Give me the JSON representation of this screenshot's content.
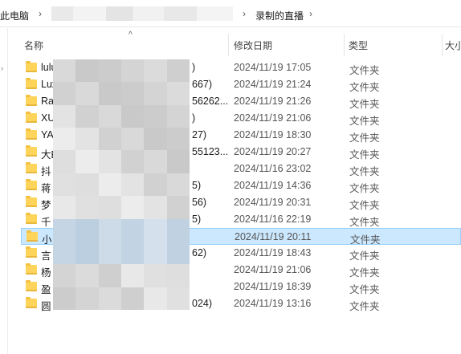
{
  "address": {
    "root": "此电脑",
    "current": "录制的直播"
  },
  "columns": {
    "name": "名称",
    "date": "修改日期",
    "type": "类型",
    "size": "大小"
  },
  "rows": [
    {
      "name": "lulu",
      "name_tail": ")",
      "date": "2024/11/19 17:05",
      "type": "文件夹"
    },
    {
      "name": "Lux",
      "name_tail": "667)",
      "date": "2024/11/19 21:24",
      "type": "文件夹"
    },
    {
      "name": "Ra",
      "name_tail": "56262...",
      "date": "2024/11/19 21:26",
      "type": "文件夹"
    },
    {
      "name": "XU",
      "name_tail": ")",
      "date": "2024/11/19 21:06",
      "type": "文件夹"
    },
    {
      "name": "YA",
      "name_tail": "27)",
      "date": "2024/11/19 18:30",
      "type": "文件夹"
    },
    {
      "name": "大B",
      "name_tail": "55123...",
      "date": "2024/11/19 20:27",
      "type": "文件夹"
    },
    {
      "name": "抖",
      "name_tail": "",
      "date": "2024/11/16 23:02",
      "type": "文件夹"
    },
    {
      "name": "蒋",
      "name_tail": "5)",
      "date": "2024/11/19 14:36",
      "type": "文件夹"
    },
    {
      "name": "梦",
      "name_tail": "56)",
      "date": "2024/11/19 20:31",
      "type": "文件夹"
    },
    {
      "name": "千",
      "name_tail": "5)",
      "date": "2024/11/16 22:19",
      "type": "文件夹"
    },
    {
      "name": "小",
      "name_tail": "",
      "date": "2024/11/19 20:11",
      "type": "文件夹"
    },
    {
      "name": "言",
      "name_tail": "62)",
      "date": "2024/11/19 18:43",
      "type": "文件夹"
    },
    {
      "name": "杨",
      "name_tail": "",
      "date": "2024/11/19 21:06",
      "type": "文件夹"
    },
    {
      "name": "盈",
      "name_tail": "",
      "date": "2024/11/19 18:39",
      "type": "文件夹"
    },
    {
      "name": "圆",
      "name_tail": "024)",
      "date": "2024/11/19 13:16",
      "type": "文件夹"
    }
  ],
  "selected_row_index": 10,
  "colors": {
    "selection_bg": "#cce8ff",
    "selection_border": "#99d1ff",
    "folder": "#ffd45a"
  }
}
